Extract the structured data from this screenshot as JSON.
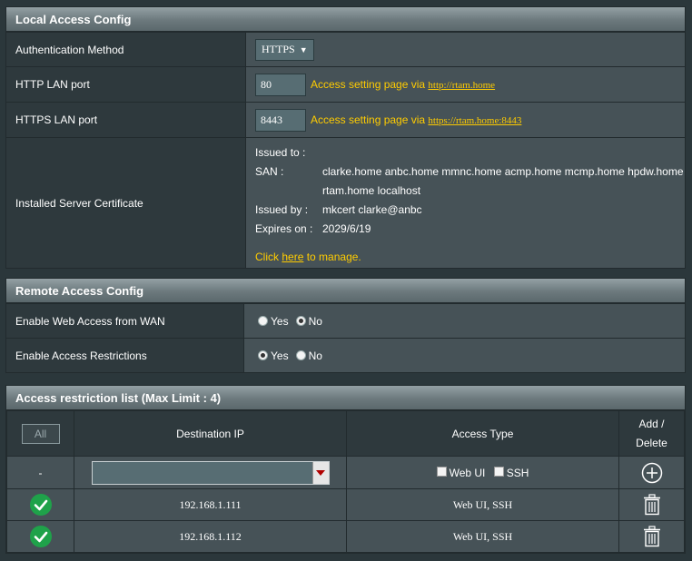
{
  "local": {
    "title": "Local Access Config",
    "auth_label": "Authentication Method",
    "auth_value": "HTTPS",
    "http_label": "HTTP LAN port",
    "http_port": "80",
    "http_hint": "Access setting page via",
    "http_link": "http://rtam.home",
    "https_label": "HTTPS LAN port",
    "https_port": "8443",
    "https_hint": "Access setting page via",
    "https_link": "https://rtam.home:8443",
    "cert_label": "Installed Server Certificate",
    "issued_to_key": "Issued to :",
    "san_key": "SAN :",
    "san_value_1": "clarke.home anbc.home mmnc.home acmp.home mcmp.home hpdw.home",
    "san_value_2": "rtam.home localhost",
    "issued_by_key": "Issued by :",
    "issued_by_value": "mkcert clarke@anbc",
    "expires_key": "Expires on :",
    "expires_value": "2029/6/19",
    "manage_prefix": "Click",
    "manage_link": "here",
    "manage_suffix": "to manage."
  },
  "remote": {
    "title": "Remote Access Config",
    "web_access_label": "Enable Web Access from WAN",
    "web_access_value": "No",
    "restrictions_label": "Enable Access Restrictions",
    "restrictions_value": "Yes",
    "yes": "Yes",
    "no": "No"
  },
  "list": {
    "title": "Access restriction list (Max Limit : 4)",
    "headers": {
      "all": "All",
      "dest_ip": "Destination IP",
      "access_type": "Access Type",
      "add_delete_1": "Add /",
      "add_delete_2": "Delete"
    },
    "new_row": {
      "dash": "-",
      "web_ui": "Web UI",
      "ssh": "SSH"
    },
    "rows": [
      {
        "ip": "192.168.1.111",
        "type": "Web UI, SSH"
      },
      {
        "ip": "192.168.1.112",
        "type": "Web UI, SSH"
      }
    ]
  },
  "colors": {
    "accent_yellow": "#ffcc00",
    "check_green": "#1fa24a",
    "header_gray": "#7d8a8e"
  }
}
